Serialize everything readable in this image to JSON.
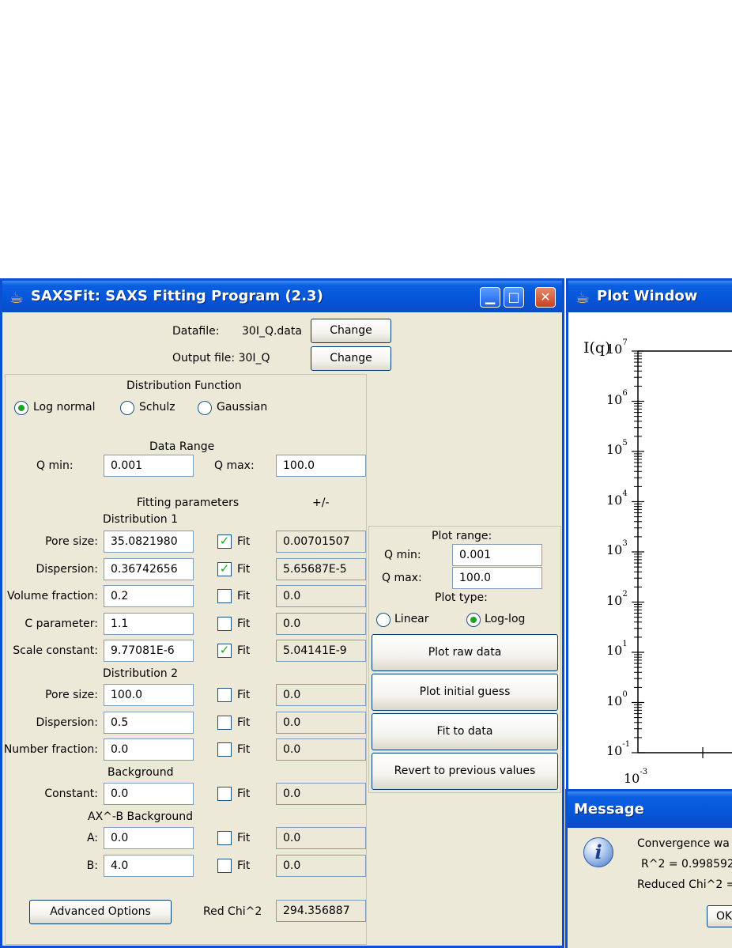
{
  "main": {
    "title": "SAXSFit: SAXS Fitting Program  (2.3)",
    "datafile_label": "Datafile:",
    "datafile_value": "30I_Q.data",
    "change_label": "Change",
    "output_label": "Output file: 30I_Q",
    "dist_func_title": "Distribution Function",
    "dist_options": [
      "Log normal",
      "Schulz",
      "Gaussian"
    ],
    "dist_selected": "Log normal",
    "data_range_title": "Data Range",
    "qmin_label": "Q min:",
    "qmin_value": "0.001",
    "qmax_label": "Q max:",
    "qmax_value": "100.0",
    "fitting_title": "Fitting parameters",
    "plusminus": "+/-",
    "fit_label": "Fit",
    "dist1_title": "Distribution 1",
    "dist1": [
      {
        "label": "Pore size:",
        "value": "35.0821980",
        "fit": true,
        "err": "0.00701507"
      },
      {
        "label": "Dispersion:",
        "value": "0.36742656",
        "fit": true,
        "err": "5.65687E-5"
      },
      {
        "label": "Volume fraction:",
        "value": "0.2",
        "fit": false,
        "err": "0.0"
      },
      {
        "label": "C parameter:",
        "value": "1.1",
        "fit": false,
        "err": "0.0"
      },
      {
        "label": "Scale constant:",
        "value": "9.77081E-6",
        "fit": true,
        "err": "5.04141E-9"
      }
    ],
    "dist2_title": "Distribution 2",
    "dist2": [
      {
        "label": "Pore size:",
        "value": "100.0",
        "fit": false,
        "err": "0.0"
      },
      {
        "label": "Dispersion:",
        "value": "0.5",
        "fit": false,
        "err": "0.0"
      },
      {
        "label": "Number fraction:",
        "value": "0.0",
        "fit": false,
        "err": "0.0"
      }
    ],
    "background_title": "Background",
    "background": {
      "label": "Constant:",
      "value": "0.0",
      "fit": false,
      "err": "0.0"
    },
    "axb_title": "AX^-B Background",
    "axb": [
      {
        "label": "A:",
        "value": "0.0",
        "fit": false,
        "err": "0.0"
      },
      {
        "label": "B:",
        "value": "4.0",
        "fit": false,
        "err": "0.0"
      }
    ],
    "advanced_label": "Advanced Options",
    "redchi_label": "Red Chi^2",
    "redchi_value": "294.356887",
    "plot_range_title": "Plot range:",
    "plot_qmin_label": "Q min:",
    "plot_qmin_value": "0.001",
    "plot_qmax_label": "Q max:",
    "plot_qmax_value": "100.0",
    "plot_type_title": "Plot type:",
    "plot_type_options": [
      "Linear",
      "Log-log"
    ],
    "plot_type_selected": "Log-log",
    "actions": [
      "Plot raw data",
      "Plot initial guess",
      "Fit to data",
      "Revert to previous values"
    ]
  },
  "plot": {
    "title": "Plot Window",
    "ylabel": "I(q)",
    "y_exponents": [
      "7",
      "6",
      "5",
      "4",
      "3",
      "2",
      "1",
      "0",
      "-1"
    ],
    "x_first_exponent": "-3",
    "tick_base": "10"
  },
  "message": {
    "title": "Message",
    "lines": [
      "Convergence wa",
      "R^2 = 0.998592",
      "Reduced Chi^2 ="
    ],
    "ok_label": "OK"
  },
  "colors": {
    "titlebar": "#0655d8",
    "window_bg": "#ece9d8",
    "check": "#21a121"
  }
}
